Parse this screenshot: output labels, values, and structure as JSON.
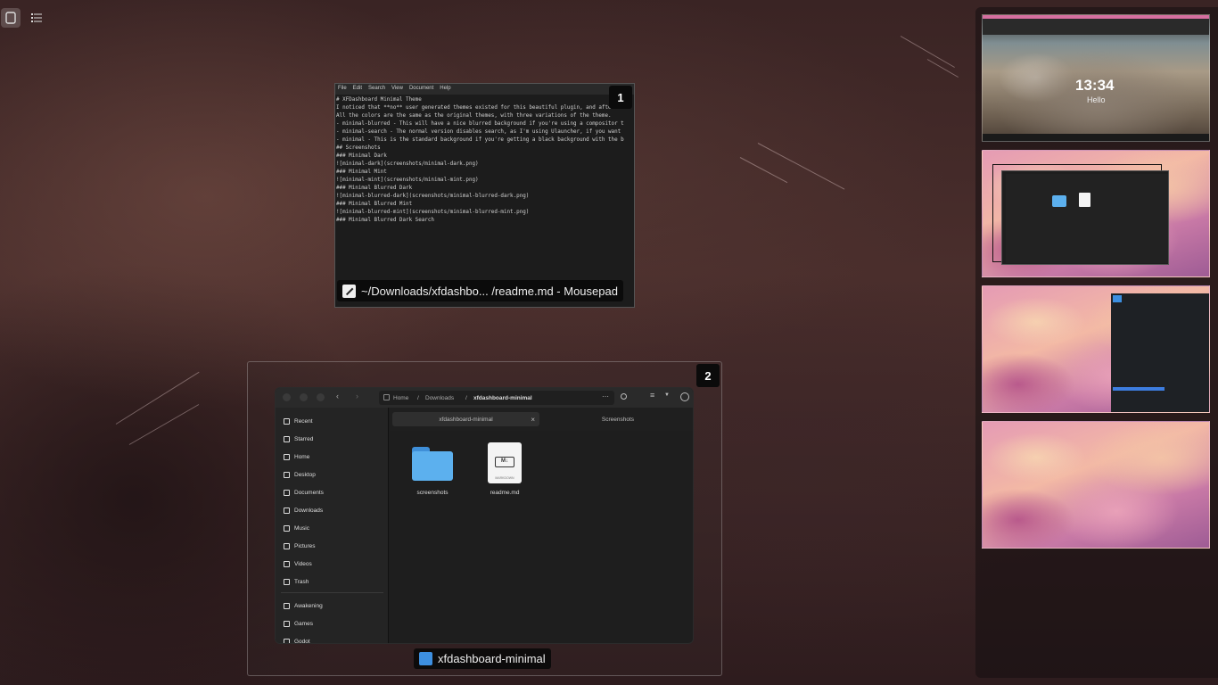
{
  "top_buttons": [
    {
      "name": "windows-view",
      "icon": "window-icon",
      "active": true
    },
    {
      "name": "apps-view",
      "icon": "list-icon",
      "active": false
    }
  ],
  "windows": [
    {
      "number": "1",
      "title": "~/Downloads/xfdashbo... /readme.md - Mousepad",
      "app_icon": "mousepad-icon",
      "menu": [
        "File",
        "Edit",
        "Search",
        "View",
        "Document",
        "Help"
      ],
      "lines": [
        "# XFDashboard Minimal Theme",
        "",
        "I noticed that **no** user generated themes existed for this beautiful plugin, and after st",
        "",
        "All the colors are the same as the original themes, with three variations of the theme.",
        "- minimal-blurred - This will have a nice blurred background if you're using a compositor t",
        "- minimal-search - The normal version disables search, as I'm using Ulauncher, if you want",
        "- minimal - This is the standard background if you're getting a black background with the b",
        "",
        "## Screenshots",
        "### Minimal Dark",
        "![minimal-dark](screenshots/minimal-dark.png)",
        "",
        "### Minimal Mint",
        "![minimal-mint](screenshots/minimal-mint.png)",
        "",
        "### Minimal Blurred Dark",
        "![minimal-blurred-dark](screenshots/minimal-blurred-dark.png)",
        "",
        "### Minimal Blurred Mint",
        "![minimal-blurred-mint](screenshots/minimal-blurred-mint.png)",
        "",
        "### Minimal Blurred Dark Search"
      ]
    },
    {
      "number": "2",
      "title": "xfdashboard-minimal",
      "app_icon": "files-icon",
      "breadcrumbs": [
        "Home",
        "Downloads",
        "xfdashboard-minimal"
      ],
      "tabs": [
        "xfdashboard-minimal",
        "Screenshots"
      ],
      "sidebar": [
        {
          "label": "Recent",
          "icon": "clock-icon"
        },
        {
          "label": "Starred",
          "icon": "star-icon"
        },
        {
          "label": "Home",
          "icon": "home-icon"
        },
        {
          "label": "Desktop",
          "icon": "desktop-icon"
        },
        {
          "label": "Documents",
          "icon": "documents-icon"
        },
        {
          "label": "Downloads",
          "icon": "downloads-icon"
        },
        {
          "label": "Music",
          "icon": "music-icon"
        },
        {
          "label": "Pictures",
          "icon": "pictures-icon"
        },
        {
          "label": "Videos",
          "icon": "videos-icon"
        },
        {
          "label": "Trash",
          "icon": "trash-icon"
        },
        {
          "label": "Awakening",
          "icon": "folder-icon"
        },
        {
          "label": "Games",
          "icon": "folder-icon"
        },
        {
          "label": "Godot",
          "icon": "folder-icon"
        }
      ],
      "files": [
        {
          "label": "screenshots",
          "icon": "folder-icon"
        },
        {
          "label": "readme.md",
          "icon": "markdown-file-icon",
          "badge": "MARKDOWN"
        }
      ]
    }
  ],
  "workspaces": [
    {
      "name": "workspace-1",
      "clock": "13:34",
      "greeting": "Hello"
    },
    {
      "name": "workspace-2"
    },
    {
      "name": "workspace-3"
    },
    {
      "name": "workspace-4"
    }
  ]
}
